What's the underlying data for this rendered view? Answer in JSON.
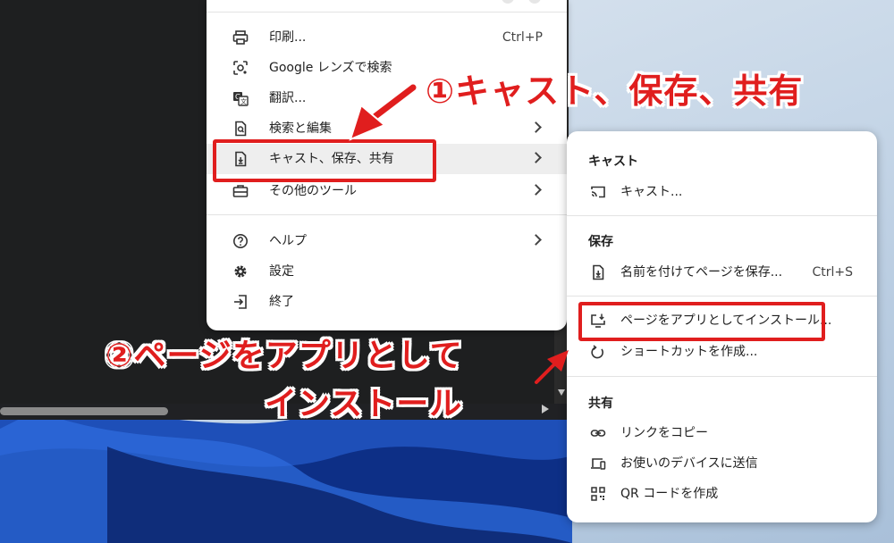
{
  "main_menu": {
    "items": [
      {
        "label": "印刷...",
        "shortcut": "Ctrl+P",
        "icon": "printer-icon"
      },
      {
        "label": "Google レンズで検索",
        "icon": "lens-icon"
      },
      {
        "label": "翻訳...",
        "icon": "translate-icon"
      },
      {
        "label": "検索と編集",
        "icon": "find-icon",
        "submenu": true
      },
      {
        "label": "キャスト、保存、共有",
        "icon": "cast-save-share-icon",
        "submenu": true,
        "highlighted": true
      },
      {
        "label": "その他のツール",
        "icon": "toolbox-icon",
        "submenu": true
      },
      {
        "label": "ヘルプ",
        "icon": "help-icon",
        "submenu": true
      },
      {
        "label": "設定",
        "icon": "gear-icon"
      },
      {
        "label": "終了",
        "icon": "exit-icon"
      }
    ]
  },
  "submenu": {
    "cast_header": "キャスト",
    "cast_item": "キャスト...",
    "save_header": "保存",
    "save_page": "名前を付けてページを保存...",
    "save_page_shortcut": "Ctrl+S",
    "install_page": "ページをアプリとしてインストール...",
    "create_shortcut": "ショートカットを作成...",
    "share_header": "共有",
    "copy_link": "リンクをコピー",
    "send_devices": "お使いのデバイスに送信",
    "qr_code": "QR コードを作成"
  },
  "annotations": {
    "step1": "①キャスト、保存、共有",
    "step2_line1": "②ページをアプリとして",
    "step2_line2": "インストール",
    "color": "#e01e1e"
  }
}
